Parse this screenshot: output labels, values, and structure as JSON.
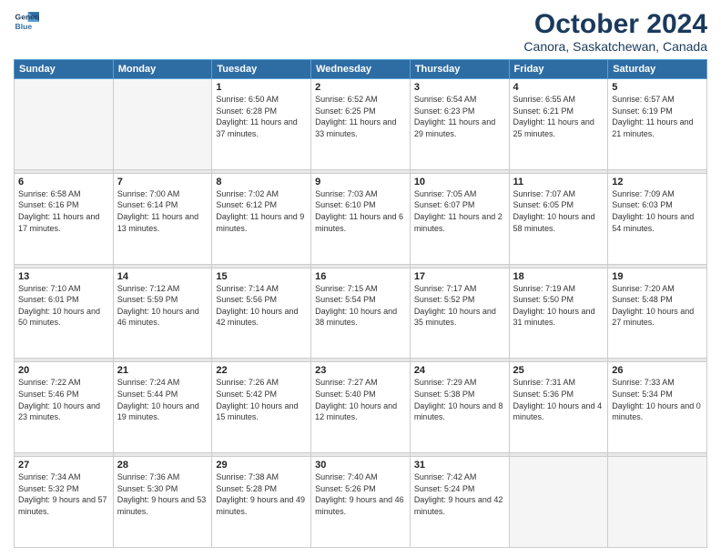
{
  "logo": {
    "line1": "General",
    "line2": "Blue"
  },
  "title": "October 2024",
  "subtitle": "Canora, Saskatchewan, Canada",
  "weekdays": [
    "Sunday",
    "Monday",
    "Tuesday",
    "Wednesday",
    "Thursday",
    "Friday",
    "Saturday"
  ],
  "weeks": [
    [
      {
        "day": "",
        "info": ""
      },
      {
        "day": "",
        "info": ""
      },
      {
        "day": "1",
        "info": "Sunrise: 6:50 AM\nSunset: 6:28 PM\nDaylight: 11 hours and 37 minutes."
      },
      {
        "day": "2",
        "info": "Sunrise: 6:52 AM\nSunset: 6:25 PM\nDaylight: 11 hours and 33 minutes."
      },
      {
        "day": "3",
        "info": "Sunrise: 6:54 AM\nSunset: 6:23 PM\nDaylight: 11 hours and 29 minutes."
      },
      {
        "day": "4",
        "info": "Sunrise: 6:55 AM\nSunset: 6:21 PM\nDaylight: 11 hours and 25 minutes."
      },
      {
        "day": "5",
        "info": "Sunrise: 6:57 AM\nSunset: 6:19 PM\nDaylight: 11 hours and 21 minutes."
      }
    ],
    [
      {
        "day": "6",
        "info": "Sunrise: 6:58 AM\nSunset: 6:16 PM\nDaylight: 11 hours and 17 minutes."
      },
      {
        "day": "7",
        "info": "Sunrise: 7:00 AM\nSunset: 6:14 PM\nDaylight: 11 hours and 13 minutes."
      },
      {
        "day": "8",
        "info": "Sunrise: 7:02 AM\nSunset: 6:12 PM\nDaylight: 11 hours and 9 minutes."
      },
      {
        "day": "9",
        "info": "Sunrise: 7:03 AM\nSunset: 6:10 PM\nDaylight: 11 hours and 6 minutes."
      },
      {
        "day": "10",
        "info": "Sunrise: 7:05 AM\nSunset: 6:07 PM\nDaylight: 11 hours and 2 minutes."
      },
      {
        "day": "11",
        "info": "Sunrise: 7:07 AM\nSunset: 6:05 PM\nDaylight: 10 hours and 58 minutes."
      },
      {
        "day": "12",
        "info": "Sunrise: 7:09 AM\nSunset: 6:03 PM\nDaylight: 10 hours and 54 minutes."
      }
    ],
    [
      {
        "day": "13",
        "info": "Sunrise: 7:10 AM\nSunset: 6:01 PM\nDaylight: 10 hours and 50 minutes."
      },
      {
        "day": "14",
        "info": "Sunrise: 7:12 AM\nSunset: 5:59 PM\nDaylight: 10 hours and 46 minutes."
      },
      {
        "day": "15",
        "info": "Sunrise: 7:14 AM\nSunset: 5:56 PM\nDaylight: 10 hours and 42 minutes."
      },
      {
        "day": "16",
        "info": "Sunrise: 7:15 AM\nSunset: 5:54 PM\nDaylight: 10 hours and 38 minutes."
      },
      {
        "day": "17",
        "info": "Sunrise: 7:17 AM\nSunset: 5:52 PM\nDaylight: 10 hours and 35 minutes."
      },
      {
        "day": "18",
        "info": "Sunrise: 7:19 AM\nSunset: 5:50 PM\nDaylight: 10 hours and 31 minutes."
      },
      {
        "day": "19",
        "info": "Sunrise: 7:20 AM\nSunset: 5:48 PM\nDaylight: 10 hours and 27 minutes."
      }
    ],
    [
      {
        "day": "20",
        "info": "Sunrise: 7:22 AM\nSunset: 5:46 PM\nDaylight: 10 hours and 23 minutes."
      },
      {
        "day": "21",
        "info": "Sunrise: 7:24 AM\nSunset: 5:44 PM\nDaylight: 10 hours and 19 minutes."
      },
      {
        "day": "22",
        "info": "Sunrise: 7:26 AM\nSunset: 5:42 PM\nDaylight: 10 hours and 15 minutes."
      },
      {
        "day": "23",
        "info": "Sunrise: 7:27 AM\nSunset: 5:40 PM\nDaylight: 10 hours and 12 minutes."
      },
      {
        "day": "24",
        "info": "Sunrise: 7:29 AM\nSunset: 5:38 PM\nDaylight: 10 hours and 8 minutes."
      },
      {
        "day": "25",
        "info": "Sunrise: 7:31 AM\nSunset: 5:36 PM\nDaylight: 10 hours and 4 minutes."
      },
      {
        "day": "26",
        "info": "Sunrise: 7:33 AM\nSunset: 5:34 PM\nDaylight: 10 hours and 0 minutes."
      }
    ],
    [
      {
        "day": "27",
        "info": "Sunrise: 7:34 AM\nSunset: 5:32 PM\nDaylight: 9 hours and 57 minutes."
      },
      {
        "day": "28",
        "info": "Sunrise: 7:36 AM\nSunset: 5:30 PM\nDaylight: 9 hours and 53 minutes."
      },
      {
        "day": "29",
        "info": "Sunrise: 7:38 AM\nSunset: 5:28 PM\nDaylight: 9 hours and 49 minutes."
      },
      {
        "day": "30",
        "info": "Sunrise: 7:40 AM\nSunset: 5:26 PM\nDaylight: 9 hours and 46 minutes."
      },
      {
        "day": "31",
        "info": "Sunrise: 7:42 AM\nSunset: 5:24 PM\nDaylight: 9 hours and 42 minutes."
      },
      {
        "day": "",
        "info": ""
      },
      {
        "day": "",
        "info": ""
      }
    ]
  ]
}
